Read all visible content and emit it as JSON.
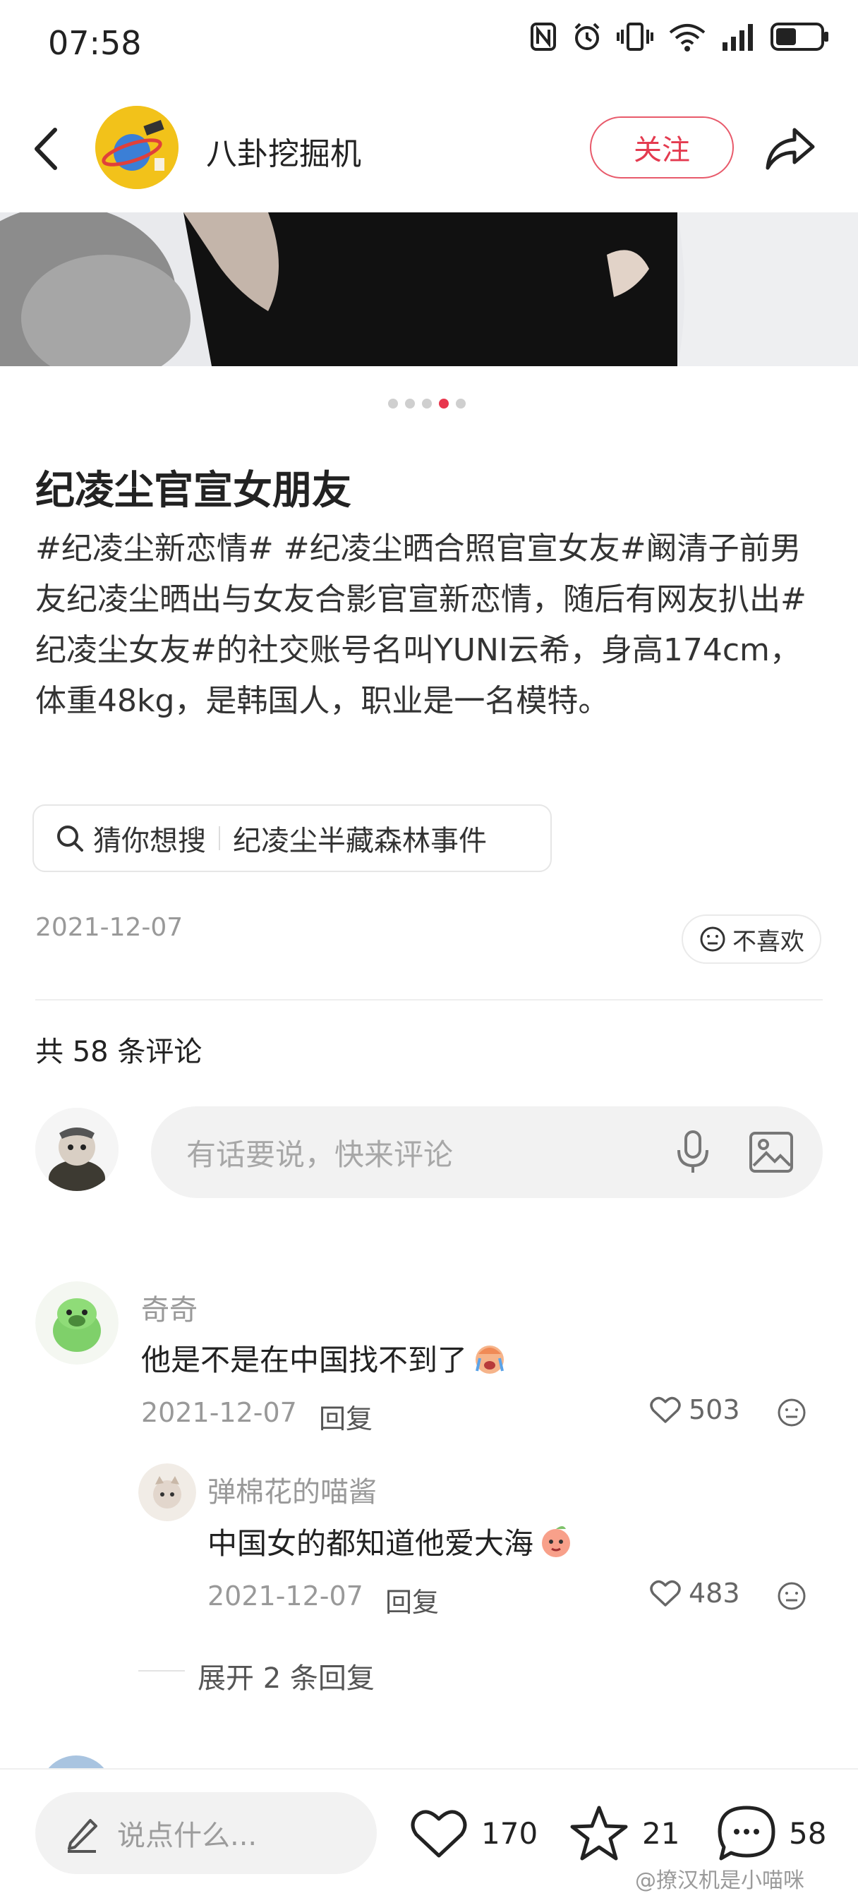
{
  "status_bar": {
    "time": "07:58"
  },
  "header": {
    "name": "八卦挖掘机",
    "follow_label": "关注"
  },
  "pager": {
    "total": 5,
    "active": 4
  },
  "post": {
    "title": "纪凌尘官宣女朋友",
    "body": "#纪凌尘新恋情# #纪凌尘晒合照官宣女友#阚清子前男友纪凌尘晒出与女友合影官宣新恋情，随后有网友扒出#纪凌尘女友#的社交账号名叫YUNI云希，身高174cm，体重48kg，是韩国人，职业是一名模特。",
    "suggest_label": "猜你想搜",
    "suggest_query": "纪凌尘半藏森林事件",
    "date": "2021-12-07",
    "dislike_label": "不喜欢"
  },
  "comments_section": {
    "count_label": "共 58 条评论",
    "input_placeholder": "有话要说，快来评论"
  },
  "comments": [
    {
      "name": "奇奇",
      "text": "他是不是在中国找不到了",
      "date": "2021-12-07",
      "reply_label": "回复",
      "likes": "503"
    }
  ],
  "replies": [
    {
      "name": "弹棉花的喵酱",
      "text": "中国女的都知道他爱大海",
      "date": "2021-12-07",
      "reply_label": "回复",
      "likes": "483"
    }
  ],
  "expand_label": "展开 2 条回复",
  "bottom_bar": {
    "say_placeholder": "说点什么...",
    "likes": "170",
    "stars": "21",
    "comments": "58"
  },
  "watermark": "@撩汉机是小喵咪",
  "colors": {
    "accent": "#e8364d",
    "follow_border": "#e85a6b"
  }
}
